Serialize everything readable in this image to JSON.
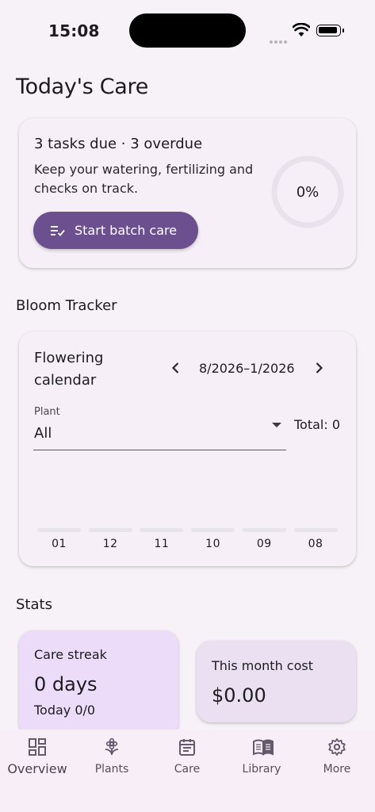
{
  "status_bar": {
    "time": "15:08"
  },
  "page": {
    "title": "Today's Care"
  },
  "care_card": {
    "headline": "3 tasks due · 3 overdue",
    "description": "Keep your watering, fertilizing and checks on track.",
    "button_label": "Start batch care",
    "progress_text": "0%",
    "progress_fraction": 0
  },
  "bloom": {
    "section_title": "Bloom Tracker",
    "heading": "Flowering calendar",
    "range": "8/2026–1/2026",
    "plant_label": "Plant",
    "plant_value": "All",
    "total": "Total: 0",
    "months": [
      "01",
      "12",
      "11",
      "10",
      "09",
      "08"
    ],
    "counts": [
      0,
      0,
      0,
      0,
      0,
      0
    ]
  },
  "stats": {
    "section_title": "Stats",
    "streak_title": "Care streak",
    "streak_value": "0 days",
    "streak_today": "Today 0/0",
    "cost_title": "This month cost",
    "cost_value": "$0.00"
  },
  "nav": {
    "items": [
      {
        "label": "Overview",
        "icon": "dashboard-icon",
        "active": true
      },
      {
        "label": "Plants",
        "icon": "flower-icon",
        "active": false
      },
      {
        "label": "Care",
        "icon": "calendar-icon",
        "active": false
      },
      {
        "label": "Library",
        "icon": "book-icon",
        "active": false
      },
      {
        "label": "More",
        "icon": "gear-icon",
        "active": false
      }
    ]
  },
  "colors": {
    "primary": "#6c4f8f",
    "background": "#f7f2f8",
    "streak_card": "#ecdcf9",
    "cost_card": "#ebe0f2"
  }
}
